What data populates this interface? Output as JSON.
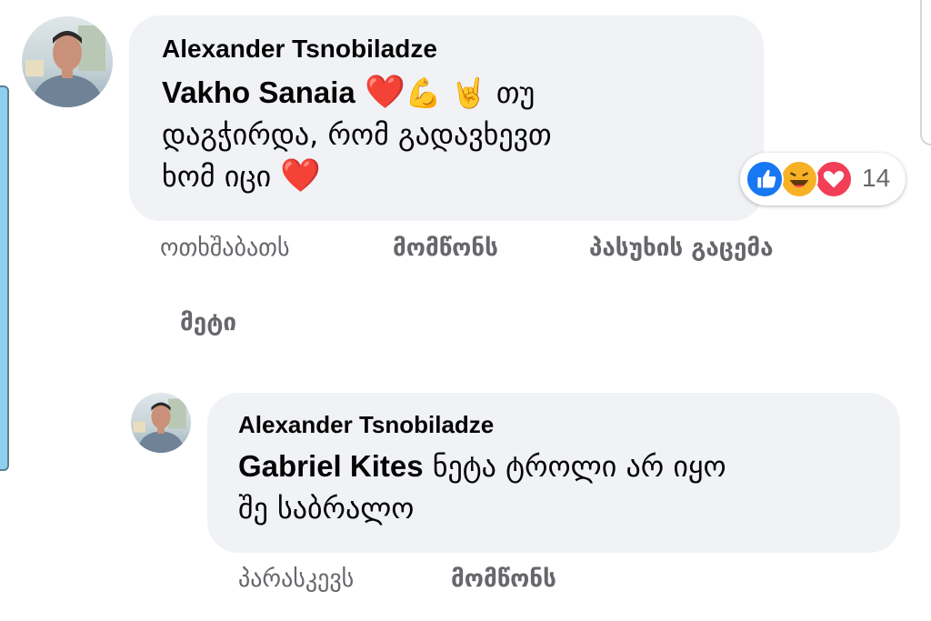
{
  "comment": {
    "author": "Alexander Tsnobiladze",
    "mention": "Vakho Sanaia",
    "emojis": [
      "❤️",
      "💪",
      "🤘"
    ],
    "text_line1": "თუ",
    "text_line2": "დაგჭირდა, რომ გადავხევთ",
    "text_line3": "ხომ იცი",
    "end_emoji": "❤️",
    "reactions": {
      "icons": [
        "like-icon",
        "haha-icon",
        "love-icon"
      ],
      "colors": {
        "like": "#1877f2",
        "haha": "#f7b125",
        "love": "#f33e58"
      },
      "count": "14"
    },
    "actions": {
      "time": "ოთხშაბათს",
      "like": "მომწონს",
      "reply": "პასუხის გაცემა"
    },
    "more": "მეტი"
  },
  "reply": {
    "author": "Alexander Tsnobiladze",
    "mention": "Gabriel Kites",
    "text_line1": "ნეტა ტროლი არ იყო",
    "text_line2": "შე საბრალო",
    "actions": {
      "time": "პარასკევს",
      "like": "მომწონს"
    }
  }
}
